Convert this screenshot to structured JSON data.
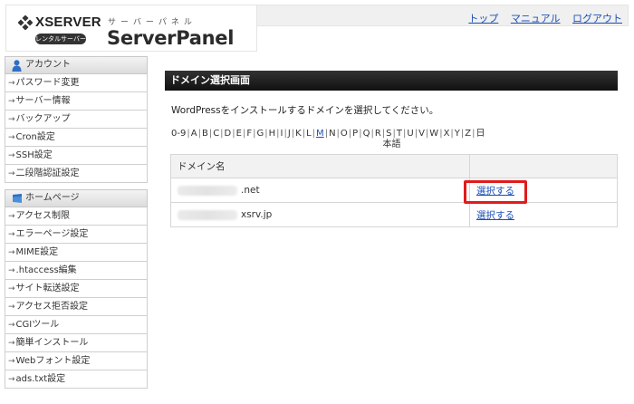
{
  "header": {
    "brand": "XSERVER",
    "rental_badge": "レンタルサーバー",
    "panel_kana": "サーバーパネル",
    "panel_name": "ServerPanel",
    "links": [
      "トップ",
      "マニュアル",
      "ログアウト"
    ]
  },
  "sidebar": {
    "account_section": {
      "title": "アカウント",
      "items": [
        "パスワード変更",
        "サーバー情報",
        "バックアップ",
        "Cron設定",
        "SSH設定",
        "二段階認証設定"
      ]
    },
    "homepage_section": {
      "title": "ホームページ",
      "items": [
        "アクセス制限",
        "エラーページ設定",
        "MIME設定",
        ".htaccess編集",
        "サイト転送設定",
        "アクセス拒否設定",
        "CGIツール",
        "簡単インストール",
        "Webフォント設定",
        "ads.txt設定"
      ]
    }
  },
  "main": {
    "title": "ドメイン選択画面",
    "instruction": "WordPressをインストールするドメインを選択してください。",
    "alpha_nav": [
      "0-9",
      "A",
      "B",
      "C",
      "D",
      "E",
      "F",
      "G",
      "H",
      "I",
      "J",
      "K",
      "L",
      "M",
      "N",
      "O",
      "P",
      "Q",
      "R",
      "S",
      "T",
      "U",
      "V",
      "W",
      "X",
      "Y",
      "Z",
      "日本語"
    ],
    "alpha_active": "M",
    "table": {
      "header": "ドメイン名",
      "rows": [
        {
          "domain_suffix": ".net",
          "action": "選択する"
        },
        {
          "domain_suffix": "xsrv.jp",
          "action": "選択する"
        }
      ]
    }
  },
  "colors": {
    "link": "#1a4fb8",
    "highlight": "#e21b1b",
    "title_bar": "#111111"
  }
}
